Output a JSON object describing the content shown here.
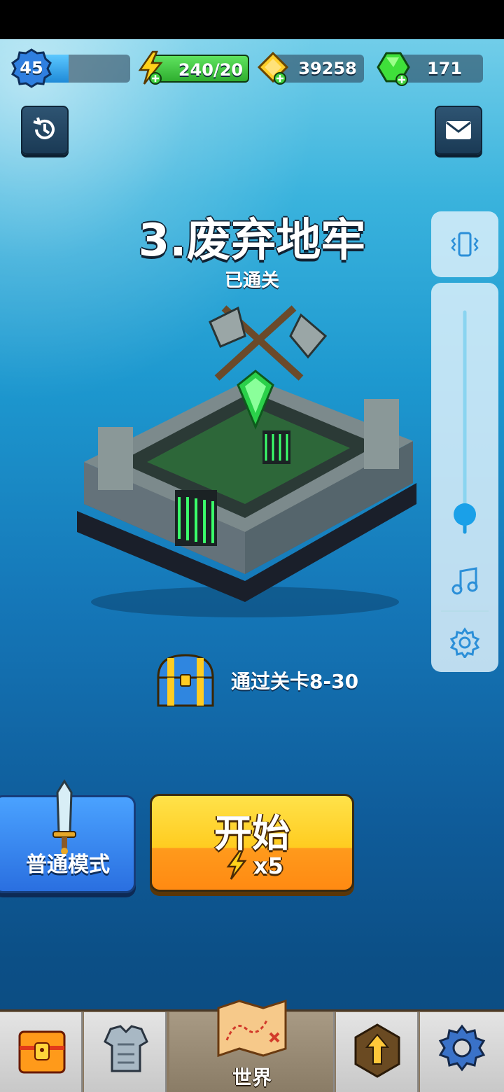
{
  "header": {
    "player_level": "45",
    "xp_progress": 0.3,
    "energy": "240/20",
    "gold": "39258",
    "gems": "171"
  },
  "level": {
    "title": "3.废弃地牢",
    "status": "已通关",
    "reward_text": "通过关卡8-30"
  },
  "actions": {
    "mode_label": "普通模式",
    "start_label": "开始",
    "start_cost": "x5"
  },
  "side_panel": {
    "volume_level": 0.08
  },
  "nav": {
    "active_tab_label": "世界"
  },
  "colors": {
    "energy_bar": "#3ccf3c",
    "start_button": "#ffcc20",
    "mode_button": "#3a8cf0"
  }
}
